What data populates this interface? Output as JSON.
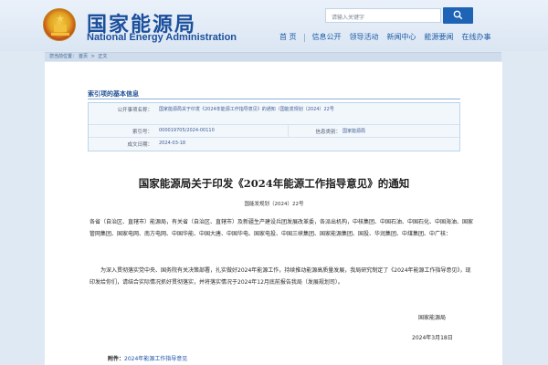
{
  "header": {
    "title_cn": "国家能源局",
    "title_en": "National Energy Administration",
    "search_placeholder": "请输入关键字"
  },
  "nav": [
    {
      "label": "首 页"
    },
    {
      "label": "信息公开"
    },
    {
      "label": "领导活动"
    },
    {
      "label": "新闻中心"
    },
    {
      "label": "能源要闻"
    },
    {
      "label": "在线办事"
    }
  ],
  "breadcrumb": [
    "您当前位置：",
    "首页",
    " > ",
    "正文"
  ],
  "info": {
    "section_title": "索引项的基本信息",
    "rows": [
      {
        "label": "公开事项名称：",
        "value": "国家能源局关于印发《2024年能源工作指导意见》的通知（国能发规划〔2024〕22号"
      },
      {
        "label": "索引号：",
        "value": "000019705/2024-00110",
        "label2": "信息类别：",
        "value2": "国家能源局"
      },
      {
        "label": "成文日期：",
        "value": "2024-03-18"
      }
    ]
  },
  "document": {
    "title": "国家能源局关于印发《2024年能源工作指导意见》的通知",
    "number": "国能发规划〔2024〕22号",
    "para1": "各省（自治区、直辖市）能源局，有关省（自治区、直辖市）及新疆生产建设兵团发展改革委，各派出机构，中核集团、中国石油、中国石化、中国海油、国家管网集团、国家电网、南方电网、中国华能、中国大唐、中国华电、国家电投、中国三峡集团、国家能源集团、国投、华润集团、中煤集团、中广核：",
    "para2": "为深入贯彻落实党中央、国务院有关决策部署，扎实做好2024年能源工作，持续推动能源高质量发展，我局研究制定了《2024年能源工作指导意见》，现印发给你们，请结合实际情况抓好贯彻落实，并将落实情况于2024年12月底前报告我局（发展规划司）。",
    "sign_org": "国家能源局",
    "sign_date": "2024年3月18日"
  },
  "attachment": {
    "label": "附件：",
    "link": "2024年能源工作指导意见"
  },
  "colors": {
    "brand_blue": "#1b4f9c",
    "search_button": "#1f63b7",
    "page_bg": "#dfe9f4",
    "link": "#1b52a6"
  }
}
